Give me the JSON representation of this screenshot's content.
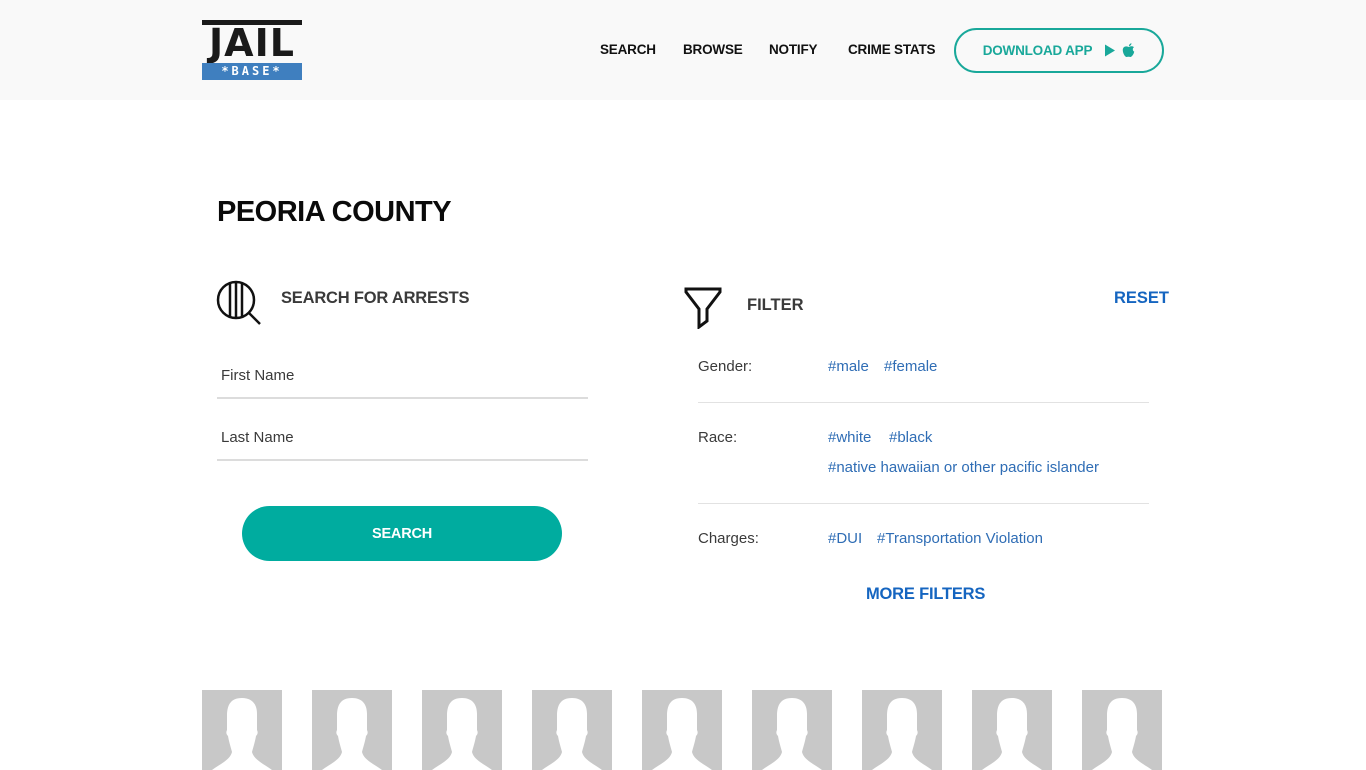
{
  "header": {
    "logo": {
      "top": "JAIL",
      "bottom": "*BASE*"
    },
    "nav": [
      {
        "label": "SEARCH"
      },
      {
        "label": "BROWSE"
      },
      {
        "label": "NOTIFY"
      },
      {
        "label": "CRIME STATS"
      }
    ],
    "download_button": {
      "label": "DOWNLOAD APP",
      "icons": [
        "google-play-icon",
        "apple-icon"
      ]
    }
  },
  "page": {
    "title": "PEORIA COUNTY"
  },
  "search": {
    "heading": "SEARCH FOR ARRESTS",
    "first_name": {
      "placeholder": "First Name",
      "value": ""
    },
    "last_name": {
      "placeholder": "Last Name",
      "value": ""
    },
    "button_label": "SEARCH"
  },
  "filter": {
    "heading": "FILTER",
    "reset_label": "RESET",
    "groups": [
      {
        "label": "Gender:",
        "tags": [
          "#male",
          "#female"
        ]
      },
      {
        "label": "Race:",
        "tags": [
          "#white",
          "#black",
          "#native hawaiian or other pacific islander"
        ]
      },
      {
        "label": "Charges:",
        "tags": [
          "#DUI",
          "#Transportation Violation"
        ]
      }
    ],
    "more_label": "MORE FILTERS"
  },
  "colors": {
    "accent_teal": "#00ac9f",
    "link_blue": "#1565c0",
    "tag_blue": "#2f6db5",
    "logo_blue": "#3f7fbf",
    "placeholder_gray": "#c8c8c8"
  },
  "mugshots": {
    "count": 9,
    "icon": "person-silhouette-icon"
  }
}
